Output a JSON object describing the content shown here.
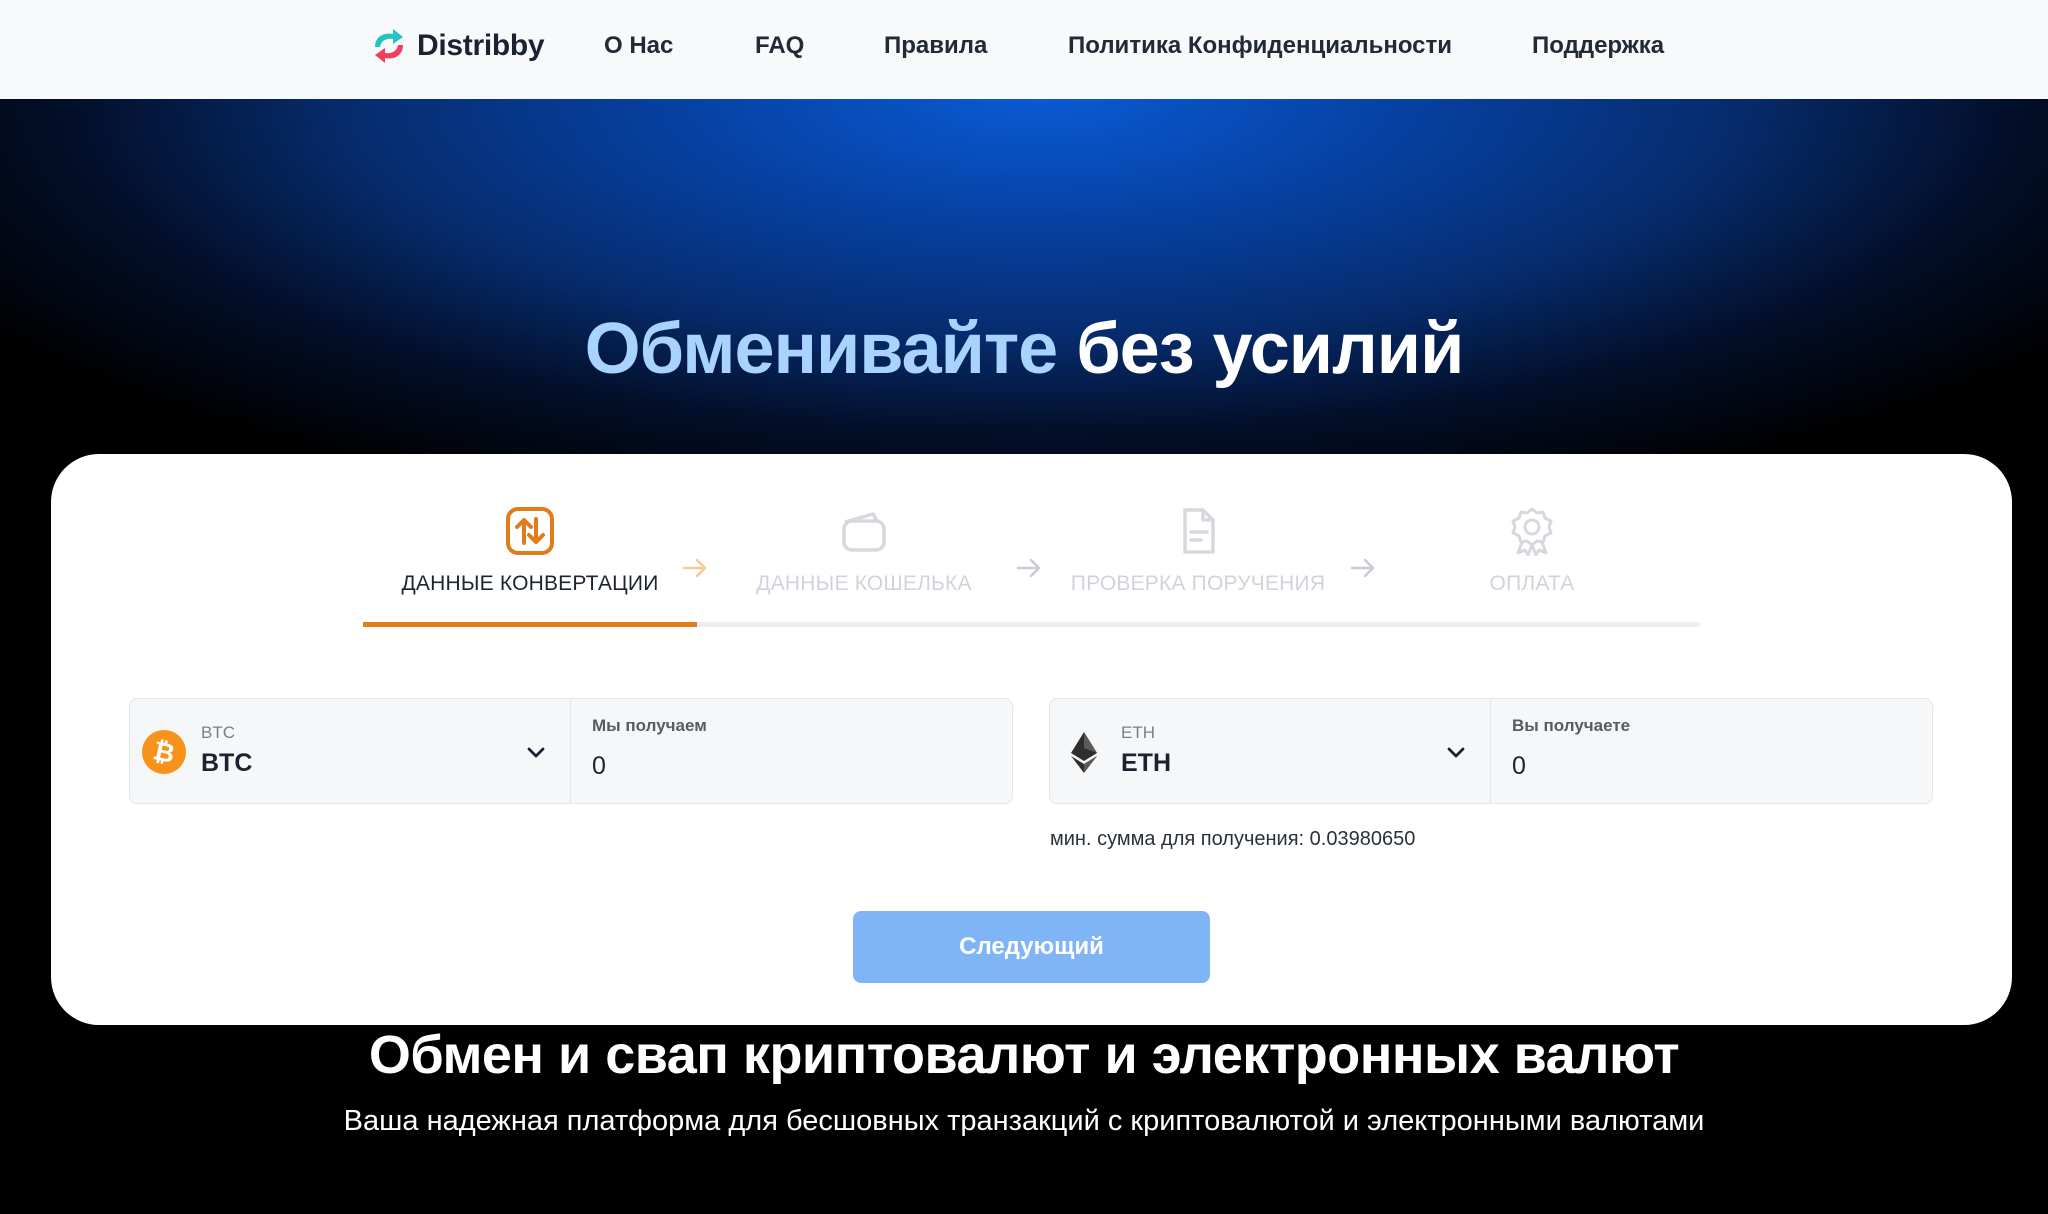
{
  "header": {
    "brand": "Distribby",
    "nav": [
      "О Нас",
      "FAQ",
      "Правила",
      "Политика Конфиденциальности",
      "Поддержка"
    ]
  },
  "hero": {
    "title_highlight": "Обменивайте",
    "title_rest": "без усилий"
  },
  "steps": [
    {
      "label": "ДАННЫЕ КОНВЕРТАЦИИ",
      "icon": "swap-icon",
      "active": true
    },
    {
      "label": "ДАННЫЕ КОШЕЛЬКА",
      "icon": "wallet-icon",
      "active": false
    },
    {
      "label": "ПРОВЕРКА ПОРУЧЕНИЯ",
      "icon": "document-icon",
      "active": false
    },
    {
      "label": "ОПЛАТА",
      "icon": "badge-icon",
      "active": false
    }
  ],
  "exchange": {
    "from": {
      "currency_small": "BTC",
      "currency": "BTC",
      "amount_label": "Мы получаем",
      "amount": "0"
    },
    "to": {
      "currency_small": "ETH",
      "currency": "ETH",
      "amount_label": "Вы получаете",
      "amount": "0"
    },
    "min_sum": "мин. сумма для получения: 0.03980650",
    "next_label": "Следующий"
  },
  "footer_section": {
    "title": "Обмен и свап криптовалют и электронных валют",
    "subtitle": "Ваша надежная платформа для бесшовных транзакций с криптовалютой и электронными валютами"
  },
  "colors": {
    "accent": "#e07c1a",
    "button": "#7fb5f7",
    "hero_highlight": "#a9d3ff",
    "btc": "#f7931a"
  }
}
